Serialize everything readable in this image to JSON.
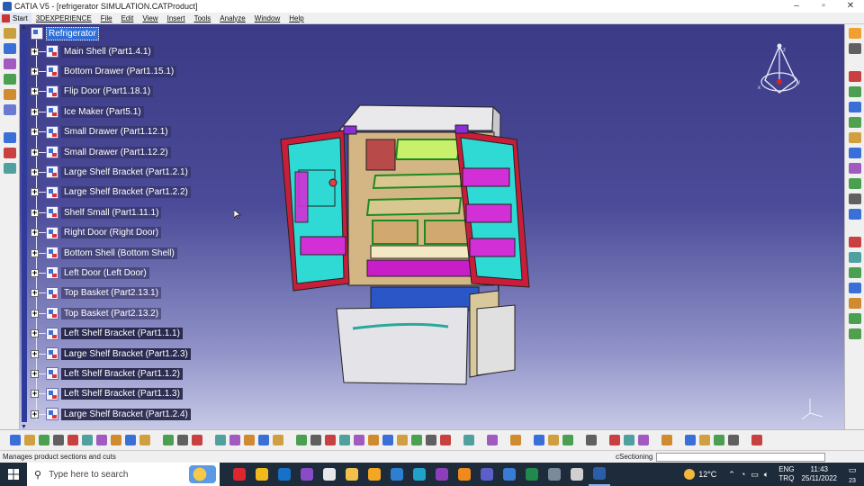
{
  "window": {
    "title": "CATIA V5 - [refrigerator SIMULATION.CATProduct]",
    "controls": [
      "–",
      "▫",
      "✕"
    ]
  },
  "menu": {
    "start": "Start",
    "items": [
      "3DEXPERIENCE",
      "File",
      "Edit",
      "View",
      "Insert",
      "Tools",
      "Analyze",
      "Window",
      "Help"
    ]
  },
  "tree": {
    "root": "Refrigerator",
    "items": [
      {
        "label": "Main Shell (Part1.4.1)",
        "selected": false
      },
      {
        "label": "Bottom Drawer (Part1.15.1)",
        "selected": false
      },
      {
        "label": "Flip Door (Part1.18.1)",
        "selected": false
      },
      {
        "label": "Ice Maker (Part5.1)",
        "selected": false
      },
      {
        "label": "Small Drawer (Part1.12.1)",
        "selected": false
      },
      {
        "label": "Small Drawer (Part1.12.2)",
        "selected": false
      },
      {
        "label": "Large Shelf Bracket (Part1.2.1)",
        "selected": false
      },
      {
        "label": "Large Shelf Bracket (Part1.2.2)",
        "selected": false
      },
      {
        "label": "Shelf Small (Part1.11.1)",
        "selected": false
      },
      {
        "label": "Right Door (Right Door)",
        "selected": false
      },
      {
        "label": "Bottom Shell (Bottom Shell)",
        "selected": false
      },
      {
        "label": "Left Door (Left Door)",
        "selected": false
      },
      {
        "label": "Top Basket (Part2.13.1)",
        "selected": false
      },
      {
        "label": "Top Basket (Part2.13.2)",
        "selected": false
      },
      {
        "label": "Left Shelf Bracket (Part1.1.1)",
        "selected": true
      },
      {
        "label": "Large Shelf Bracket (Part1.2.3)",
        "selected": true
      },
      {
        "label": "Left Shelf Bracket (Part1.1.2)",
        "selected": true
      },
      {
        "label": "Left Shelf Bracket (Part1.1.3)",
        "selected": true
      },
      {
        "label": "Large Shelf Bracket (Part1.2.4)",
        "selected": true
      }
    ]
  },
  "compass": {
    "labels": [
      "x",
      "y",
      "z"
    ]
  },
  "status": {
    "message": "Manages product sections and cuts",
    "command": "cSectioning"
  },
  "taskbar": {
    "search_placeholder": "Type here to search",
    "weather": "12°C",
    "lang_top": "ENG",
    "lang_bottom": "TRQ",
    "time": "11:43",
    "date": "25/11/2022",
    "notifications": "23",
    "apps": [
      {
        "name": "opera",
        "color": "#e0262d"
      },
      {
        "name": "chrome",
        "color": "#f1b91c"
      },
      {
        "name": "outlook",
        "color": "#1672c9"
      },
      {
        "name": "visual-studio",
        "color": "#8a4bc9"
      },
      {
        "name": "file-app",
        "color": "#e8e8e8"
      },
      {
        "name": "file-explorer",
        "color": "#f2c14b"
      },
      {
        "name": "store",
        "color": "#f5a623"
      },
      {
        "name": "mail",
        "color": "#2d7fd3"
      },
      {
        "name": "edge",
        "color": "#1fa3c9"
      },
      {
        "name": "onenote",
        "color": "#8b3fb8"
      },
      {
        "name": "search-app",
        "color": "#f08a1c"
      },
      {
        "name": "teams",
        "color": "#5b5fc7"
      },
      {
        "name": "defender",
        "color": "#3a7bd5"
      },
      {
        "name": "excel",
        "color": "#1f8a4c"
      },
      {
        "name": "browser",
        "color": "#7b8a99"
      },
      {
        "name": "settings-app",
        "color": "#d0d0d0"
      },
      {
        "name": "catia",
        "color": "#2b5ea8"
      }
    ]
  },
  "colors": {
    "viewport_top": "#3b3a86",
    "viewport_bottom": "#c7c9e6",
    "selection": "#2f6fd6",
    "fridge_red": "#c81e3a",
    "fridge_cyan": "#2fd9d4",
    "fridge_green": "#3ee03a",
    "fridge_magenta": "#d22fd6"
  }
}
